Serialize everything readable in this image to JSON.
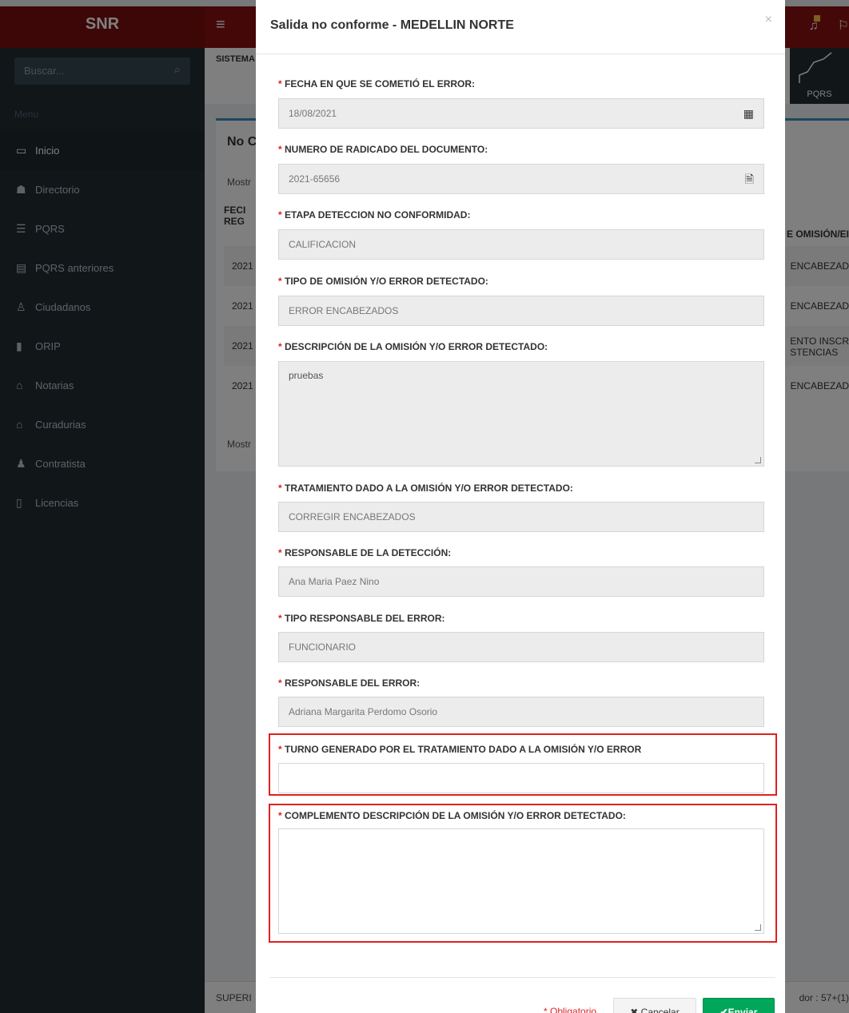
{
  "app": {
    "brand": "SNR",
    "search_placeholder": "Buscar...",
    "menu_header": "Menu",
    "menu": [
      {
        "label": "Inicio",
        "icon": "laptop-icon"
      },
      {
        "label": "Directorio",
        "icon": "users-icon"
      },
      {
        "label": "PQRS",
        "icon": "list-icon"
      },
      {
        "label": "PQRS anteriores",
        "icon": "table-icon"
      },
      {
        "label": "Ciudadanos",
        "icon": "person-icon"
      },
      {
        "label": "ORIP",
        "icon": "book-icon"
      },
      {
        "label": "Notarias",
        "icon": "bank-icon"
      },
      {
        "label": "Curadurias",
        "icon": "home-icon"
      },
      {
        "label": "Contratista",
        "icon": "user-icon"
      },
      {
        "label": "Licencias",
        "icon": "file-icon"
      }
    ],
    "content_header": "SISTEMA",
    "pqrs_tile": "PQRS",
    "box_title": "No C",
    "show_text": "Mostr",
    "table": {
      "header_left": [
        "FECI",
        "REG"
      ],
      "header_right": "E OMISIÓN/EI",
      "rows": [
        {
          "c1": "2021",
          "c2": "ENCABEZAD"
        },
        {
          "c1": "2021",
          "c2": "ENCABEZAD"
        },
        {
          "c1": "2021",
          "c2": "ENTO INSCR"
        },
        {
          "c1": "2021",
          "c2": "ENCABEZAD"
        }
      ],
      "row3_extra": "STENCIAS"
    },
    "footer_left": "SUPERI",
    "footer_right": "dor : 57+(1)"
  },
  "modal": {
    "title": "Salida no conforme - MEDELLIN NORTE",
    "close": "×",
    "fields": {
      "fecha": {
        "label": "FECHA EN QUE SE COMETIÓ EL ERROR:",
        "value": "18/08/2021"
      },
      "radicado": {
        "label": "NUMERO DE RADICADO DEL DOCUMENTO:",
        "value": "2021-65656"
      },
      "etapa": {
        "label": "ETAPA DETECCION NO CONFORMIDAD:",
        "value": "CALIFICACION"
      },
      "tipo_omision": {
        "label": "TIPO DE OMISIÓN Y/O ERROR DETECTADO:",
        "value": "ERROR ENCABEZADOS"
      },
      "descripcion": {
        "label": "DESCRIPCIÓN DE LA OMISIÓN Y/O ERROR DETECTADO:",
        "value": "pruebas"
      },
      "tratamiento": {
        "label": "TRATAMIENTO DADO A LA OMISIÓN Y/O ERROR DETECTADO:",
        "value": "CORREGIR ENCABEZADOS"
      },
      "responsable_deteccion": {
        "label": "RESPONSABLE DE LA DETECCIÓN:",
        "value": "Ana Maria Paez Nino"
      },
      "tipo_responsable": {
        "label": "TIPO RESPONSABLE DEL ERROR:",
        "value": "FUNCIONARIO"
      },
      "responsable_error": {
        "label": "RESPONSABLE DEL ERROR:",
        "value": "Adriana Margarita Perdomo Osorio"
      },
      "turno": {
        "label": "TURNO GENERADO POR EL TRATAMIENTO DADO A LA OMISIÓN Y/O ERROR",
        "value": ""
      },
      "complemento": {
        "label": "COMPLEMENTO DESCRIPCIÓN DE LA OMISIÓN Y/O ERROR DETECTADO:",
        "value": ""
      }
    },
    "required_mark": "*",
    "obligatorio": "* Obligatorio",
    "cancel": "✖ Cancelar",
    "send": "✔Enviar"
  }
}
